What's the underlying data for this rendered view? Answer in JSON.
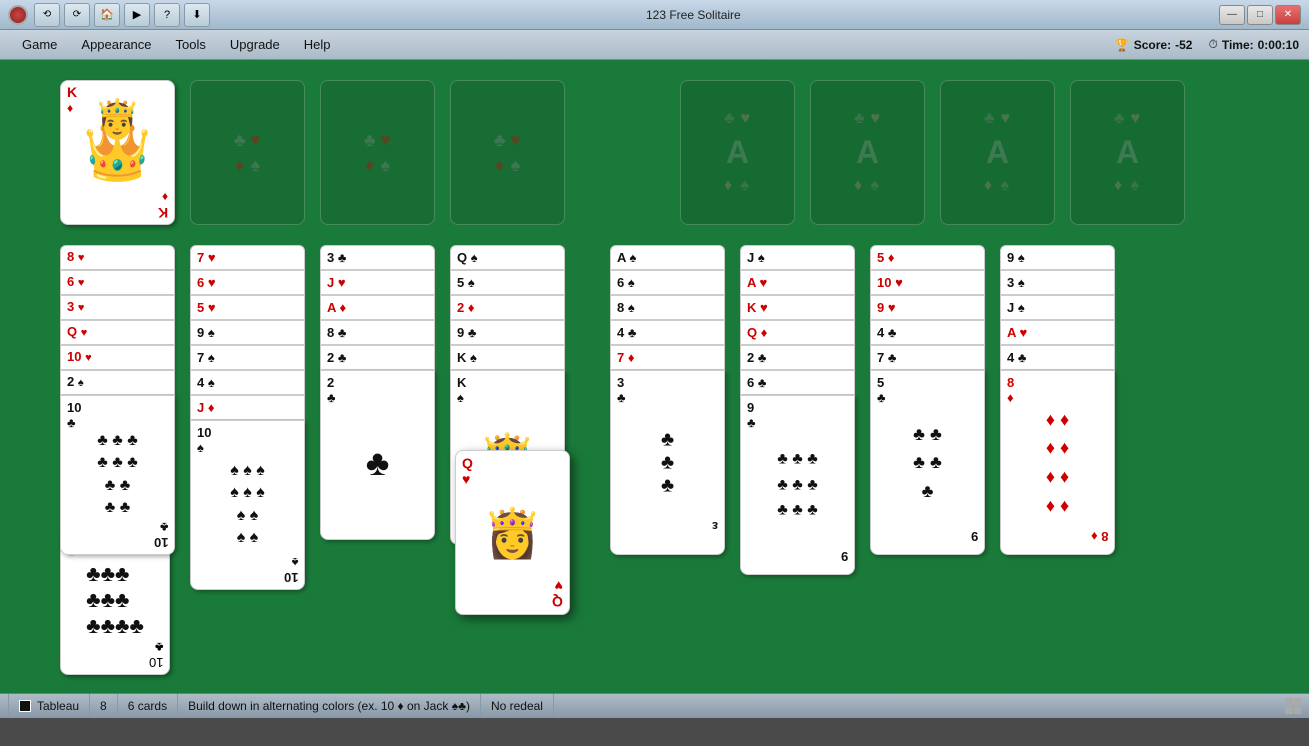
{
  "window": {
    "title": "123 Free Solitaire",
    "controls": {
      "minimize": "—",
      "maximize": "□",
      "close": "✕"
    }
  },
  "toolbar": {
    "buttons": [
      "↩",
      "↪",
      "🏠",
      "▶",
      "❓",
      "⬇"
    ]
  },
  "menu": {
    "items": [
      "Game",
      "Appearance",
      "Tools",
      "Upgrade",
      "Help"
    ]
  },
  "score": {
    "label": "Score:",
    "value": "-52",
    "time_label": "Time:",
    "time_value": "0:00:10"
  },
  "status": {
    "game_type": "Tableau",
    "columns": "8",
    "cards": "6 cards",
    "rule": "Build down in alternating colors (ex. 10 ♦ on Jack ♠♣)",
    "redeal": "No redeal"
  },
  "tableau": {
    "col1_label": "col1",
    "col2_label": "col2"
  }
}
